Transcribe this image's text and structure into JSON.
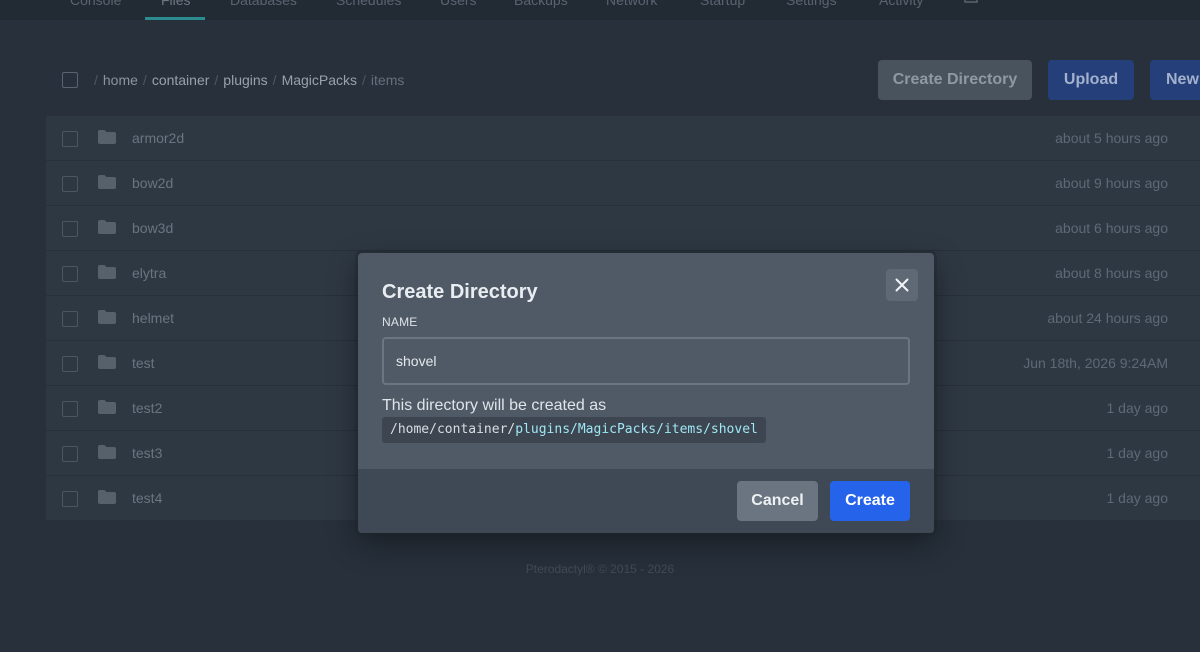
{
  "nav": {
    "items": [
      "Console",
      "Files",
      "Databases",
      "Schedules",
      "Users",
      "Backups",
      "Network",
      "Startup",
      "Settings",
      "Activity"
    ],
    "active": "Files"
  },
  "breadcrumb": {
    "root_sep": "/",
    "segments": [
      "home",
      "container",
      "plugins",
      "MagicPacks",
      "items"
    ]
  },
  "toolbar": {
    "create_directory": "Create Directory",
    "upload": "Upload",
    "new_file": "New"
  },
  "files": [
    {
      "name": "armor2d",
      "modified": "about 5 hours ago"
    },
    {
      "name": "bow2d",
      "modified": "about 9 hours ago"
    },
    {
      "name": "bow3d",
      "modified": "about 6 hours ago"
    },
    {
      "name": "elytra",
      "modified": "about 8 hours ago"
    },
    {
      "name": "helmet",
      "modified": "about 24 hours ago"
    },
    {
      "name": "test",
      "modified": "Jun 18th, 2026 9:24AM"
    },
    {
      "name": "test2",
      "modified": "1 day ago"
    },
    {
      "name": "test3",
      "modified": "1 day ago"
    },
    {
      "name": "test4",
      "modified": "1 day ago"
    }
  ],
  "footer": "Pterodactyl® © 2015 - 2026",
  "modal": {
    "title": "Create Directory",
    "name_label": "NAME",
    "name_value": "shovel",
    "helper": "This directory will be created as",
    "path_base": "/home/container/",
    "path_relative": "plugins/MagicPacks/items/shovel",
    "cancel": "Cancel",
    "create": "Create"
  },
  "colors": {
    "background": "#27303b",
    "primary": "#2563eb",
    "path_highlight": "#9fe7f5"
  }
}
